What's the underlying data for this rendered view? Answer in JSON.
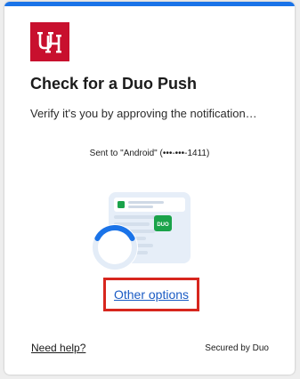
{
  "colors": {
    "accent_bar": "#1a73e8",
    "brand_red": "#c8102e",
    "link_blue": "#1a5bc4",
    "highlight_box": "#d7261e",
    "spinner_blue": "#1a73e8",
    "duo_green": "#1aa34a"
  },
  "logo": {
    "icon": "uh-logo-icon",
    "text": "UH"
  },
  "prompt": {
    "title": "Check for a Duo Push",
    "subtitle": "Verify it's you by approving the notification…",
    "sent_to": "Sent to \"Android\" (•••-•••-1411)"
  },
  "illustration": {
    "icon": "phone-notification-icon",
    "badge_text": "DUO",
    "spinner_icon": "loading-spinner-icon",
    "spinner_progress": 0.35
  },
  "actions": {
    "other_options": "Other options"
  },
  "footer": {
    "need_help": "Need help?",
    "secured_by": "Secured by Duo"
  }
}
